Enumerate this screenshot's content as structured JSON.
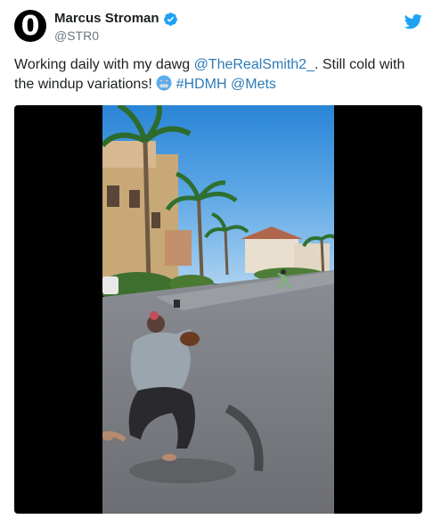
{
  "author": {
    "display_name": "Marcus Stroman",
    "handle": "@STR0",
    "avatar_glyph": "0",
    "verified": true,
    "verified_color": "#1da1f2"
  },
  "brand_icon": "twitter-bird-icon",
  "tweet": {
    "text_before": "Working daily with my dawg ",
    "mention_1": "@TheRealSmith2_",
    "text_middle": ". Still cold with the windup variations! ",
    "emoji": "cold-face-emoji",
    "hashtag": "#HDMH",
    "mention_2": "@Mets"
  },
  "colors": {
    "link": "#2b7bb9",
    "text": "#1c2022",
    "muted": "#697882",
    "brand": "#1da1f2"
  },
  "media": {
    "type": "video",
    "description_icon": "video-thumbnail"
  }
}
